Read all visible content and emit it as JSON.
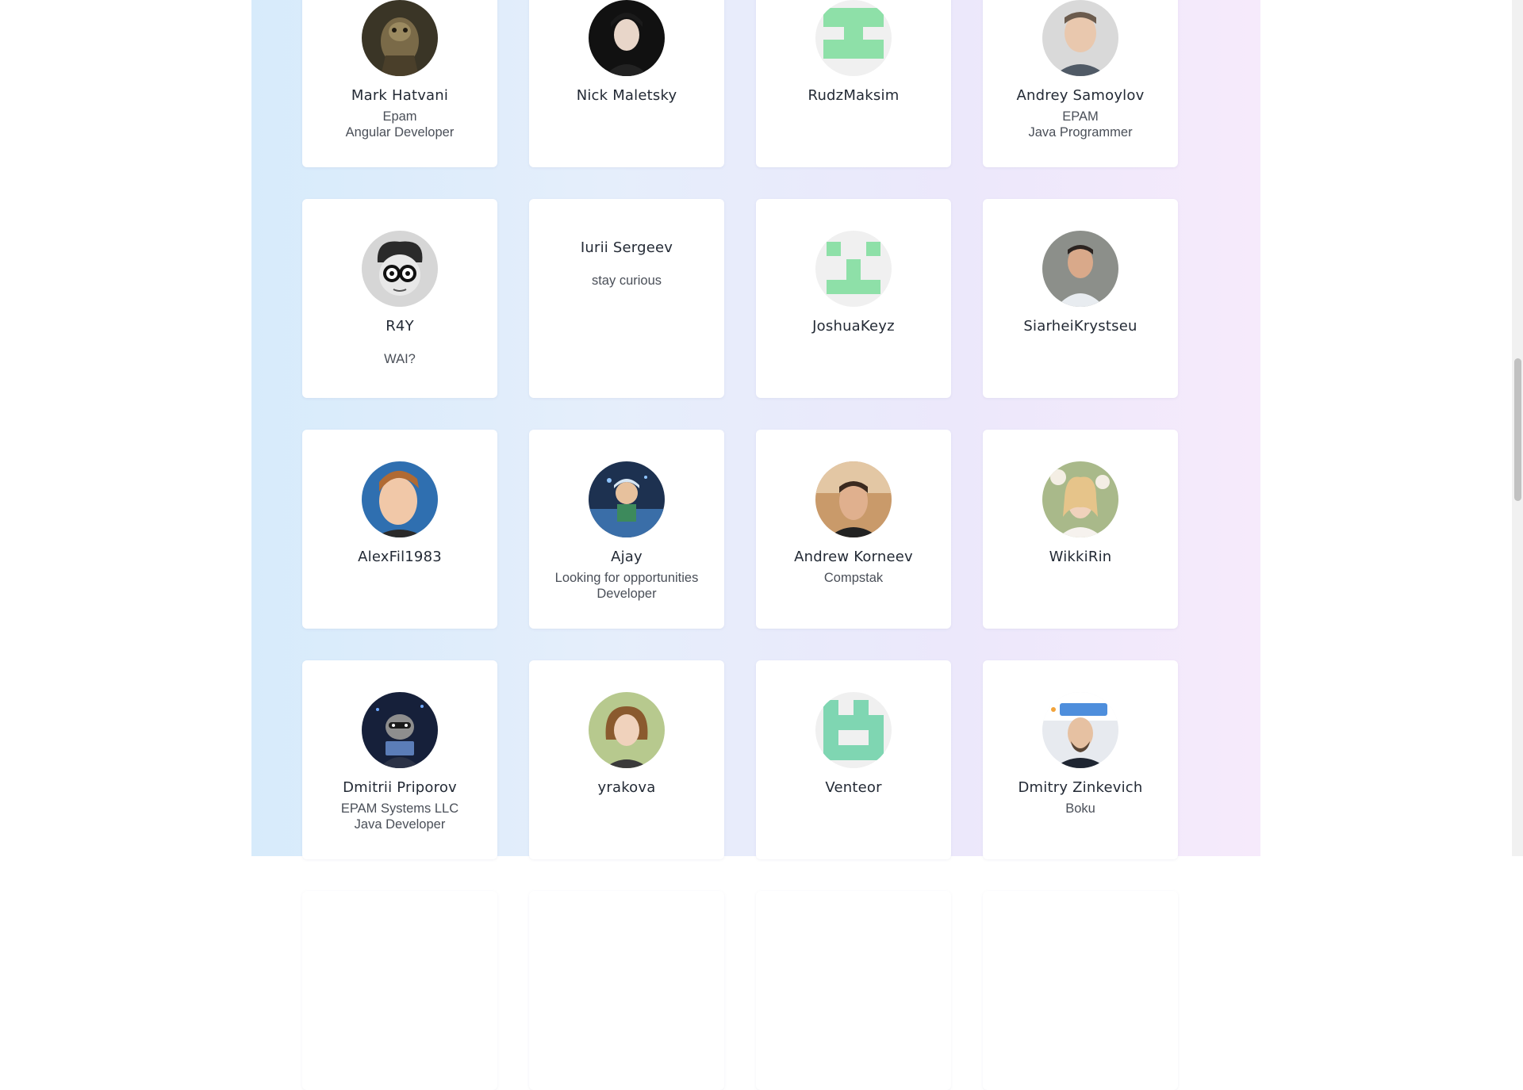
{
  "members": [
    {
      "name": "Mark Hatvani",
      "company": "Epam",
      "role": "Angular Developer",
      "bio": "",
      "avatar": "dark-fantasy-portrait-avatar"
    },
    {
      "name": "Nick Maletsky",
      "company": "",
      "role": "",
      "bio": "",
      "avatar": "dark-photo-avatar"
    },
    {
      "name": "RudzMaksim",
      "company": "",
      "role": "",
      "bio": "",
      "avatar": "identicon-avatar"
    },
    {
      "name": "Andrey Samoylov",
      "company": "EPAM",
      "role": "Java Programmer",
      "bio": "",
      "avatar": "photo-avatar"
    },
    {
      "name": "R4Y",
      "company": "",
      "role": "",
      "bio": "WAI?",
      "avatar": "cartoon-glasses-avatar"
    },
    {
      "name": "Iurii Sergeev",
      "company": "",
      "role": "",
      "bio": "stay curious",
      "avatar": ""
    },
    {
      "name": "JoshuaKeyz",
      "company": "",
      "role": "",
      "bio": "",
      "avatar": "identicon-avatar"
    },
    {
      "name": "SiarheiKrystseu",
      "company": "",
      "role": "",
      "bio": "",
      "avatar": "photo-avatar"
    },
    {
      "name": "AlexFil1983",
      "company": "",
      "role": "",
      "bio": "",
      "avatar": "photo-avatar"
    },
    {
      "name": "Ajay",
      "company": "Looking for opportunities",
      "role": "Developer",
      "bio": "",
      "avatar": "illustration-avatar"
    },
    {
      "name": "Andrew Korneev",
      "company": "Compstak",
      "role": "",
      "bio": "",
      "avatar": "photo-avatar"
    },
    {
      "name": "WikkiRin",
      "company": "",
      "role": "",
      "bio": "",
      "avatar": "photo-avatar"
    },
    {
      "name": "Dmitrii Priporov",
      "company": "EPAM Systems LLC",
      "role": "Java Developer",
      "bio": "",
      "avatar": "raccoon-avatar"
    },
    {
      "name": "yrakova",
      "company": "",
      "role": "",
      "bio": "",
      "avatar": "photo-avatar"
    },
    {
      "name": "Venteor",
      "company": "",
      "role": "",
      "bio": "",
      "avatar": "identicon-avatar"
    },
    {
      "name": "Dmitry Zinkevich",
      "company": "Boku",
      "role": "",
      "bio": "",
      "avatar": "photo-avatar"
    },
    {
      "name": "",
      "company": "",
      "role": "",
      "bio": "",
      "avatar": ""
    },
    {
      "name": "",
      "company": "",
      "role": "",
      "bio": "",
      "avatar": ""
    },
    {
      "name": "",
      "company": "",
      "role": "",
      "bio": "",
      "avatar": ""
    },
    {
      "name": "",
      "company": "",
      "role": "",
      "bio": "",
      "avatar": ""
    }
  ],
  "colors": {
    "identicon_green": "#8ee0a8",
    "identicon_teal": "#7fd6b2",
    "card_bg": "#ffffff",
    "text_primary": "#232a35",
    "text_secondary": "#4a4f58"
  }
}
